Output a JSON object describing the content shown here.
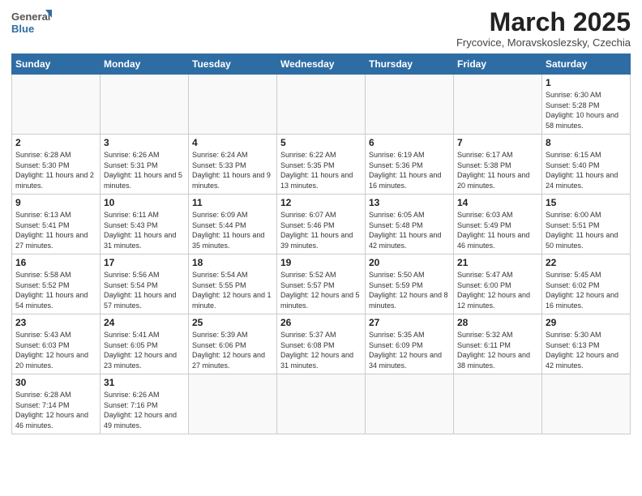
{
  "header": {
    "logo_general": "General",
    "logo_blue": "Blue",
    "month_year": "March 2025",
    "location": "Frycovice, Moravskoslezsky, Czechia"
  },
  "weekdays": [
    "Sunday",
    "Monday",
    "Tuesday",
    "Wednesday",
    "Thursday",
    "Friday",
    "Saturday"
  ],
  "weeks": [
    [
      {
        "day": "",
        "info": ""
      },
      {
        "day": "",
        "info": ""
      },
      {
        "day": "",
        "info": ""
      },
      {
        "day": "",
        "info": ""
      },
      {
        "day": "",
        "info": ""
      },
      {
        "day": "",
        "info": ""
      },
      {
        "day": "1",
        "info": "Sunrise: 6:30 AM\nSunset: 5:28 PM\nDaylight: 10 hours and 58 minutes."
      }
    ],
    [
      {
        "day": "2",
        "info": "Sunrise: 6:28 AM\nSunset: 5:30 PM\nDaylight: 11 hours and 2 minutes."
      },
      {
        "day": "3",
        "info": "Sunrise: 6:26 AM\nSunset: 5:31 PM\nDaylight: 11 hours and 5 minutes."
      },
      {
        "day": "4",
        "info": "Sunrise: 6:24 AM\nSunset: 5:33 PM\nDaylight: 11 hours and 9 minutes."
      },
      {
        "day": "5",
        "info": "Sunrise: 6:22 AM\nSunset: 5:35 PM\nDaylight: 11 hours and 13 minutes."
      },
      {
        "day": "6",
        "info": "Sunrise: 6:19 AM\nSunset: 5:36 PM\nDaylight: 11 hours and 16 minutes."
      },
      {
        "day": "7",
        "info": "Sunrise: 6:17 AM\nSunset: 5:38 PM\nDaylight: 11 hours and 20 minutes."
      },
      {
        "day": "8",
        "info": "Sunrise: 6:15 AM\nSunset: 5:40 PM\nDaylight: 11 hours and 24 minutes."
      }
    ],
    [
      {
        "day": "9",
        "info": "Sunrise: 6:13 AM\nSunset: 5:41 PM\nDaylight: 11 hours and 27 minutes."
      },
      {
        "day": "10",
        "info": "Sunrise: 6:11 AM\nSunset: 5:43 PM\nDaylight: 11 hours and 31 minutes."
      },
      {
        "day": "11",
        "info": "Sunrise: 6:09 AM\nSunset: 5:44 PM\nDaylight: 11 hours and 35 minutes."
      },
      {
        "day": "12",
        "info": "Sunrise: 6:07 AM\nSunset: 5:46 PM\nDaylight: 11 hours and 39 minutes."
      },
      {
        "day": "13",
        "info": "Sunrise: 6:05 AM\nSunset: 5:48 PM\nDaylight: 11 hours and 42 minutes."
      },
      {
        "day": "14",
        "info": "Sunrise: 6:03 AM\nSunset: 5:49 PM\nDaylight: 11 hours and 46 minutes."
      },
      {
        "day": "15",
        "info": "Sunrise: 6:00 AM\nSunset: 5:51 PM\nDaylight: 11 hours and 50 minutes."
      }
    ],
    [
      {
        "day": "16",
        "info": "Sunrise: 5:58 AM\nSunset: 5:52 PM\nDaylight: 11 hours and 54 minutes."
      },
      {
        "day": "17",
        "info": "Sunrise: 5:56 AM\nSunset: 5:54 PM\nDaylight: 11 hours and 57 minutes."
      },
      {
        "day": "18",
        "info": "Sunrise: 5:54 AM\nSunset: 5:55 PM\nDaylight: 12 hours and 1 minute."
      },
      {
        "day": "19",
        "info": "Sunrise: 5:52 AM\nSunset: 5:57 PM\nDaylight: 12 hours and 5 minutes."
      },
      {
        "day": "20",
        "info": "Sunrise: 5:50 AM\nSunset: 5:59 PM\nDaylight: 12 hours and 8 minutes."
      },
      {
        "day": "21",
        "info": "Sunrise: 5:47 AM\nSunset: 6:00 PM\nDaylight: 12 hours and 12 minutes."
      },
      {
        "day": "22",
        "info": "Sunrise: 5:45 AM\nSunset: 6:02 PM\nDaylight: 12 hours and 16 minutes."
      }
    ],
    [
      {
        "day": "23",
        "info": "Sunrise: 5:43 AM\nSunset: 6:03 PM\nDaylight: 12 hours and 20 minutes."
      },
      {
        "day": "24",
        "info": "Sunrise: 5:41 AM\nSunset: 6:05 PM\nDaylight: 12 hours and 23 minutes."
      },
      {
        "day": "25",
        "info": "Sunrise: 5:39 AM\nSunset: 6:06 PM\nDaylight: 12 hours and 27 minutes."
      },
      {
        "day": "26",
        "info": "Sunrise: 5:37 AM\nSunset: 6:08 PM\nDaylight: 12 hours and 31 minutes."
      },
      {
        "day": "27",
        "info": "Sunrise: 5:35 AM\nSunset: 6:09 PM\nDaylight: 12 hours and 34 minutes."
      },
      {
        "day": "28",
        "info": "Sunrise: 5:32 AM\nSunset: 6:11 PM\nDaylight: 12 hours and 38 minutes."
      },
      {
        "day": "29",
        "info": "Sunrise: 5:30 AM\nSunset: 6:13 PM\nDaylight: 12 hours and 42 minutes."
      }
    ],
    [
      {
        "day": "30",
        "info": "Sunrise: 6:28 AM\nSunset: 7:14 PM\nDaylight: 12 hours and 46 minutes."
      },
      {
        "day": "31",
        "info": "Sunrise: 6:26 AM\nSunset: 7:16 PM\nDaylight: 12 hours and 49 minutes."
      },
      {
        "day": "",
        "info": ""
      },
      {
        "day": "",
        "info": ""
      },
      {
        "day": "",
        "info": ""
      },
      {
        "day": "",
        "info": ""
      },
      {
        "day": "",
        "info": ""
      }
    ]
  ]
}
